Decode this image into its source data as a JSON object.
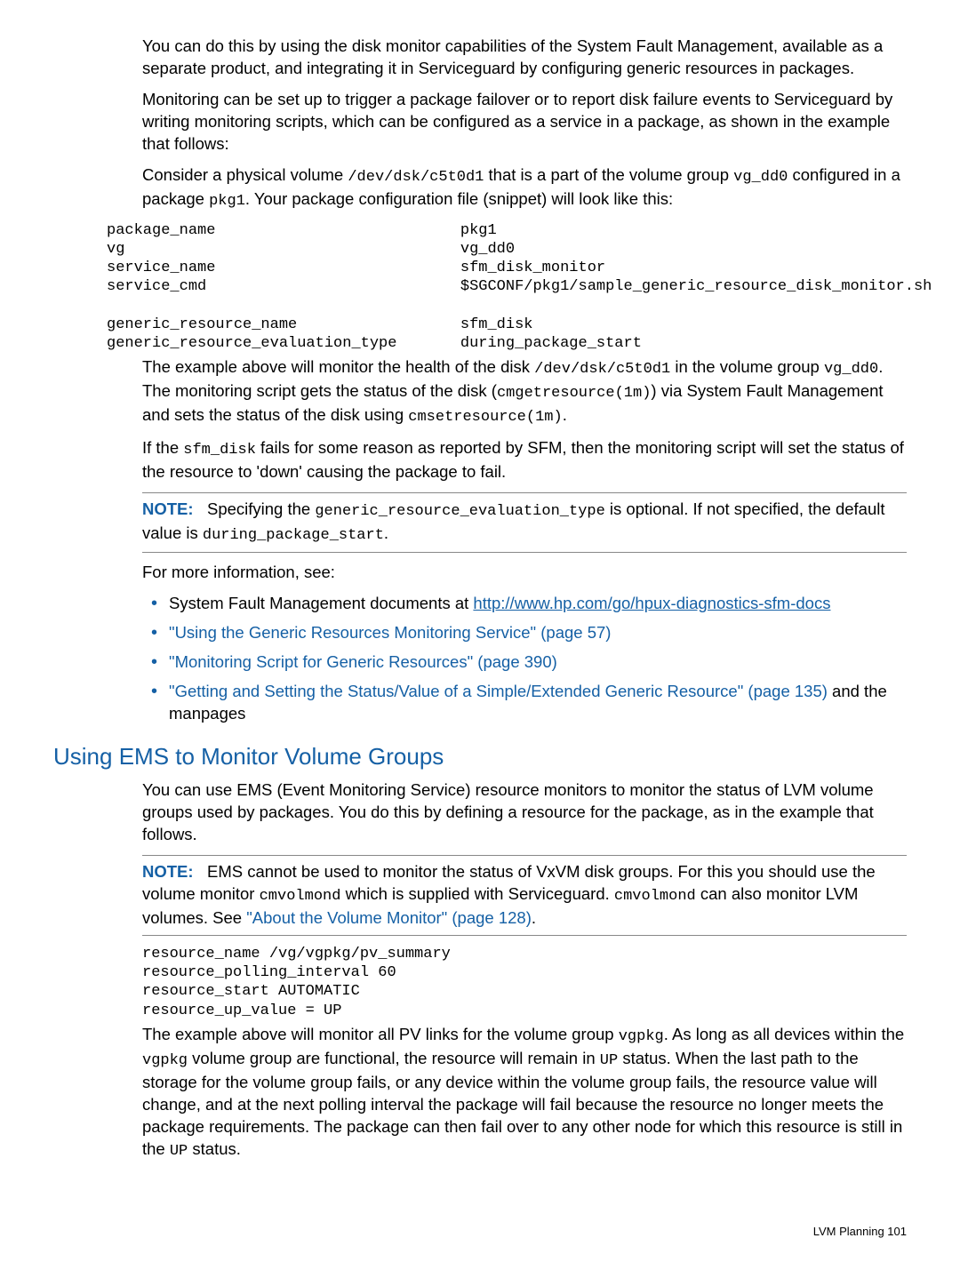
{
  "p1": "You can do this by using the disk monitor capabilities of the System Fault Management, available as a separate product, and integrating it in Serviceguard by configuring generic resources in packages.",
  "p2": "Monitoring can be set up to trigger a package failover or to report disk failure events to Serviceguard by writing monitoring scripts, which can be configured as a service in a package, as shown in the example that follows:",
  "p3a": "Consider a physical volume ",
  "p3b": "/dev/dsk/c5t0d1",
  "p3c": " that is a part of the volume group ",
  "p3d": "vg_dd0",
  "p3e": " configured in a package ",
  "p3f": "pkg1",
  "p3g": ". Your package configuration file (snippet) will look like this:",
  "code1": "package_name                           pkg1\nvg                                     vg_dd0\nservice_name                           sfm_disk_monitor\nservice_cmd                            $SGCONF/pkg1/sample_generic_resource_disk_monitor.sh\n\ngeneric_resource_name                  sfm_disk\ngeneric_resource_evaluation_type       during_package_start",
  "p4a": "The example above will monitor the health of the disk ",
  "p4b": "/dev/dsk/c5t0d1",
  "p4c": " in the volume group ",
  "p4d": "vg_dd0",
  "p4e": ". The monitoring script gets the status of the disk (",
  "p4f": "cmgetresource(1m)",
  "p4g": ") via System Fault Management and sets the status of the disk using ",
  "p4h": "cmsetresource(1m)",
  "p4i": ".",
  "p5a": "If the ",
  "p5b": "sfm_disk",
  "p5c": " fails for some reason as reported by SFM, then the monitoring script will set the status of the resource to 'down' causing the package to fail.",
  "note1": {
    "label": "NOTE:",
    "a": "Specifying the ",
    "b": "generic_resource_evaluation_type",
    "c": " is optional. If not specified, the default value is ",
    "d": "during_package_start",
    "e": "."
  },
  "p6": "For more information, see:",
  "bullets1": {
    "b1a": "System Fault Management documents at ",
    "b1b": "http://www.hp.com/go/hpux-diagnostics-sfm-docs",
    "b2": "\"Using the Generic Resources Monitoring Service\" (page 57)",
    "b3": "\"Monitoring Script for Generic Resources\" (page 390)",
    "b4a": "\"Getting and Setting the Status/Value of a Simple/Extended Generic Resource\" (page 135)",
    "b4b": " and the manpages"
  },
  "h2": "Using EMS to Monitor Volume Groups",
  "p7": "You can use EMS (Event Monitoring Service) resource monitors to monitor the status of LVM volume groups used by packages. You do this by defining a resource for the package, as in the example that follows.",
  "note2": {
    "label": "NOTE:",
    "a": "EMS cannot be used to monitor the status of VxVM disk groups. For this you should use the volume monitor ",
    "b": "cmvolmond",
    "c": " which is supplied with Serviceguard. ",
    "d": "cmvolmond",
    "e": " can also monitor LVM volumes. See ",
    "f": "\"About the Volume Monitor\" (page 128)",
    "g": "."
  },
  "code2": "resource_name /vg/vgpkg/pv_summary\nresource_polling_interval 60\nresource_start AUTOMATIC\nresource_up_value = UP",
  "p8a": "The example above will monitor all PV links for the volume group ",
  "p8b": "vgpkg",
  "p8c": ". As long as all devices within the ",
  "p8d": "vgpkg",
  "p8e": " volume group are functional, the resource will remain in ",
  "p8f": "UP",
  "p8g": " status. When the last path to the storage for the volume group fails, or any device within the volume group fails, the resource value will change, and at the next polling interval the package will fail because the resource no longer meets the package requirements. The package can then fail over to any other node for which this resource is still in the ",
  "p8h": "UP",
  "p8i": " status.",
  "footer": "LVM Planning     101"
}
